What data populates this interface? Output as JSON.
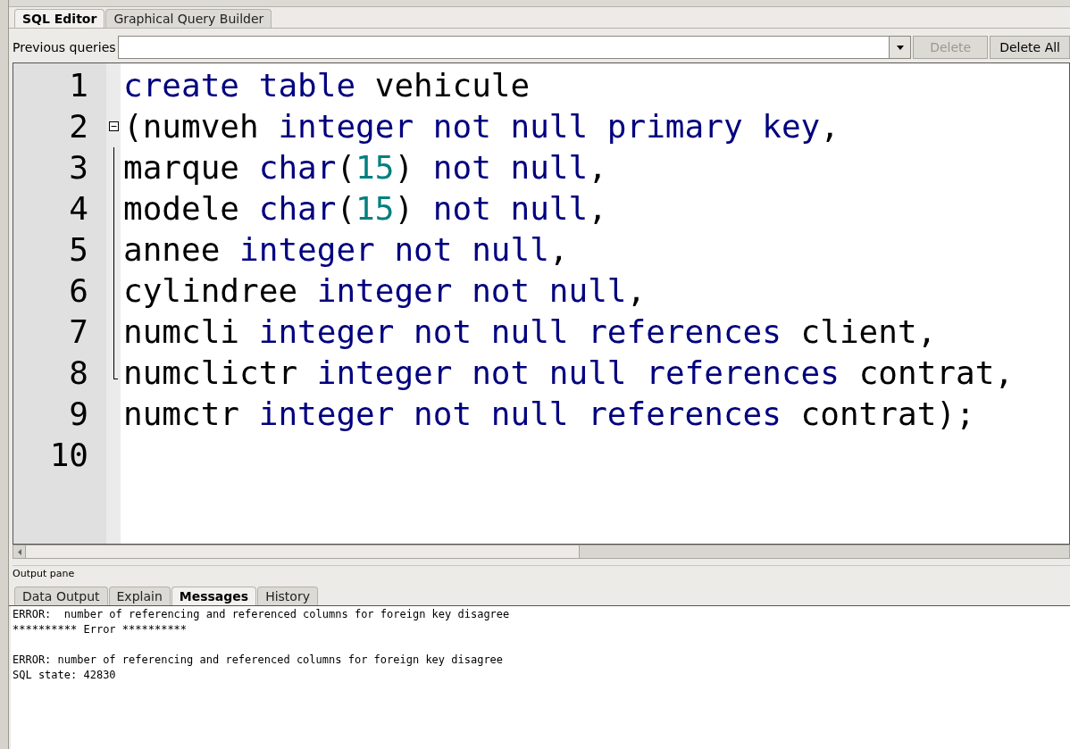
{
  "editor_tabs": [
    {
      "label": "SQL Editor",
      "selected": true
    },
    {
      "label": "Graphical Query Builder",
      "selected": false
    }
  ],
  "previous_queries": {
    "label": "Previous queries",
    "delete_button": {
      "label": "Delete",
      "disabled": true
    },
    "delete_all_button": {
      "label": "Delete All",
      "disabled": false
    }
  },
  "code_lines": [
    {
      "number": "1",
      "tokens": [
        {
          "text": "create table",
          "kind": "keyword"
        },
        {
          "text": " vehicule",
          "kind": "plain"
        }
      ]
    },
    {
      "number": "2",
      "kind": "header",
      "tokens": [
        {
          "text": "(numveh ",
          "kind": "plain"
        },
        {
          "text": "integer not null primary key",
          "kind": "keyword"
        },
        {
          "text": ",",
          "kind": "plain"
        }
      ]
    },
    {
      "number": "3",
      "kind": "body",
      "tokens": [
        {
          "text": "marque ",
          "kind": "plain"
        },
        {
          "text": "char",
          "kind": "keyword"
        },
        {
          "text": "(",
          "kind": "plain"
        },
        {
          "text": "15",
          "kind": "number"
        },
        {
          "text": ") ",
          "kind": "plain"
        },
        {
          "text": "not null",
          "kind": "keyword"
        },
        {
          "text": ",",
          "kind": "plain"
        }
      ]
    },
    {
      "number": "4",
      "kind": "body",
      "tokens": [
        {
          "text": "modele ",
          "kind": "plain"
        },
        {
          "text": "char",
          "kind": "keyword"
        },
        {
          "text": "(",
          "kind": "plain"
        },
        {
          "text": "15",
          "kind": "number"
        },
        {
          "text": ") ",
          "kind": "plain"
        },
        {
          "text": "not null",
          "kind": "keyword"
        },
        {
          "text": ",",
          "kind": "plain"
        }
      ]
    },
    {
      "number": "5",
      "kind": "body",
      "tokens": [
        {
          "text": "annee ",
          "kind": "plain"
        },
        {
          "text": "integer not null",
          "kind": "keyword"
        },
        {
          "text": ",",
          "kind": "plain"
        }
      ]
    },
    {
      "number": "6",
      "kind": "body",
      "tokens": [
        {
          "text": "cylindree ",
          "kind": "plain"
        },
        {
          "text": "integer not null",
          "kind": "keyword"
        },
        {
          "text": ",",
          "kind": "plain"
        }
      ]
    },
    {
      "number": "7",
      "kind": "body",
      "tokens": [
        {
          "text": "numcli ",
          "kind": "plain"
        },
        {
          "text": "integer not null references",
          "kind": "keyword"
        },
        {
          "text": " client,",
          "kind": "plain"
        }
      ]
    },
    {
      "number": "8",
      "kind": "footer",
      "tokens": [
        {
          "text": "numclictr ",
          "kind": "plain"
        },
        {
          "text": "integer not null references",
          "kind": "keyword"
        },
        {
          "text": " contrat,",
          "kind": "plain"
        }
      ]
    },
    {
      "number": "9",
      "tokens": [
        {
          "text": "numctr ",
          "kind": "plain"
        },
        {
          "text": "integer not null references",
          "kind": "keyword"
        },
        {
          "text": " contrat);",
          "kind": "plain"
        }
      ]
    },
    {
      "number": "10"
    }
  ],
  "output_pane": {
    "title": "Output pane",
    "tabs": [
      {
        "label": "Data Output",
        "selected": false
      },
      {
        "label": "Explain",
        "selected": false
      },
      {
        "label": "Messages",
        "selected": true
      },
      {
        "label": "History",
        "selected": false
      }
    ],
    "message_blocks": [
      [
        "ERROR:  number of referencing and referenced columns for foreign key disagree",
        "********** Error **********"
      ],
      [
        "ERROR: number of referencing and referenced columns for foreign key disagree",
        "SQL state: 42830"
      ]
    ]
  }
}
